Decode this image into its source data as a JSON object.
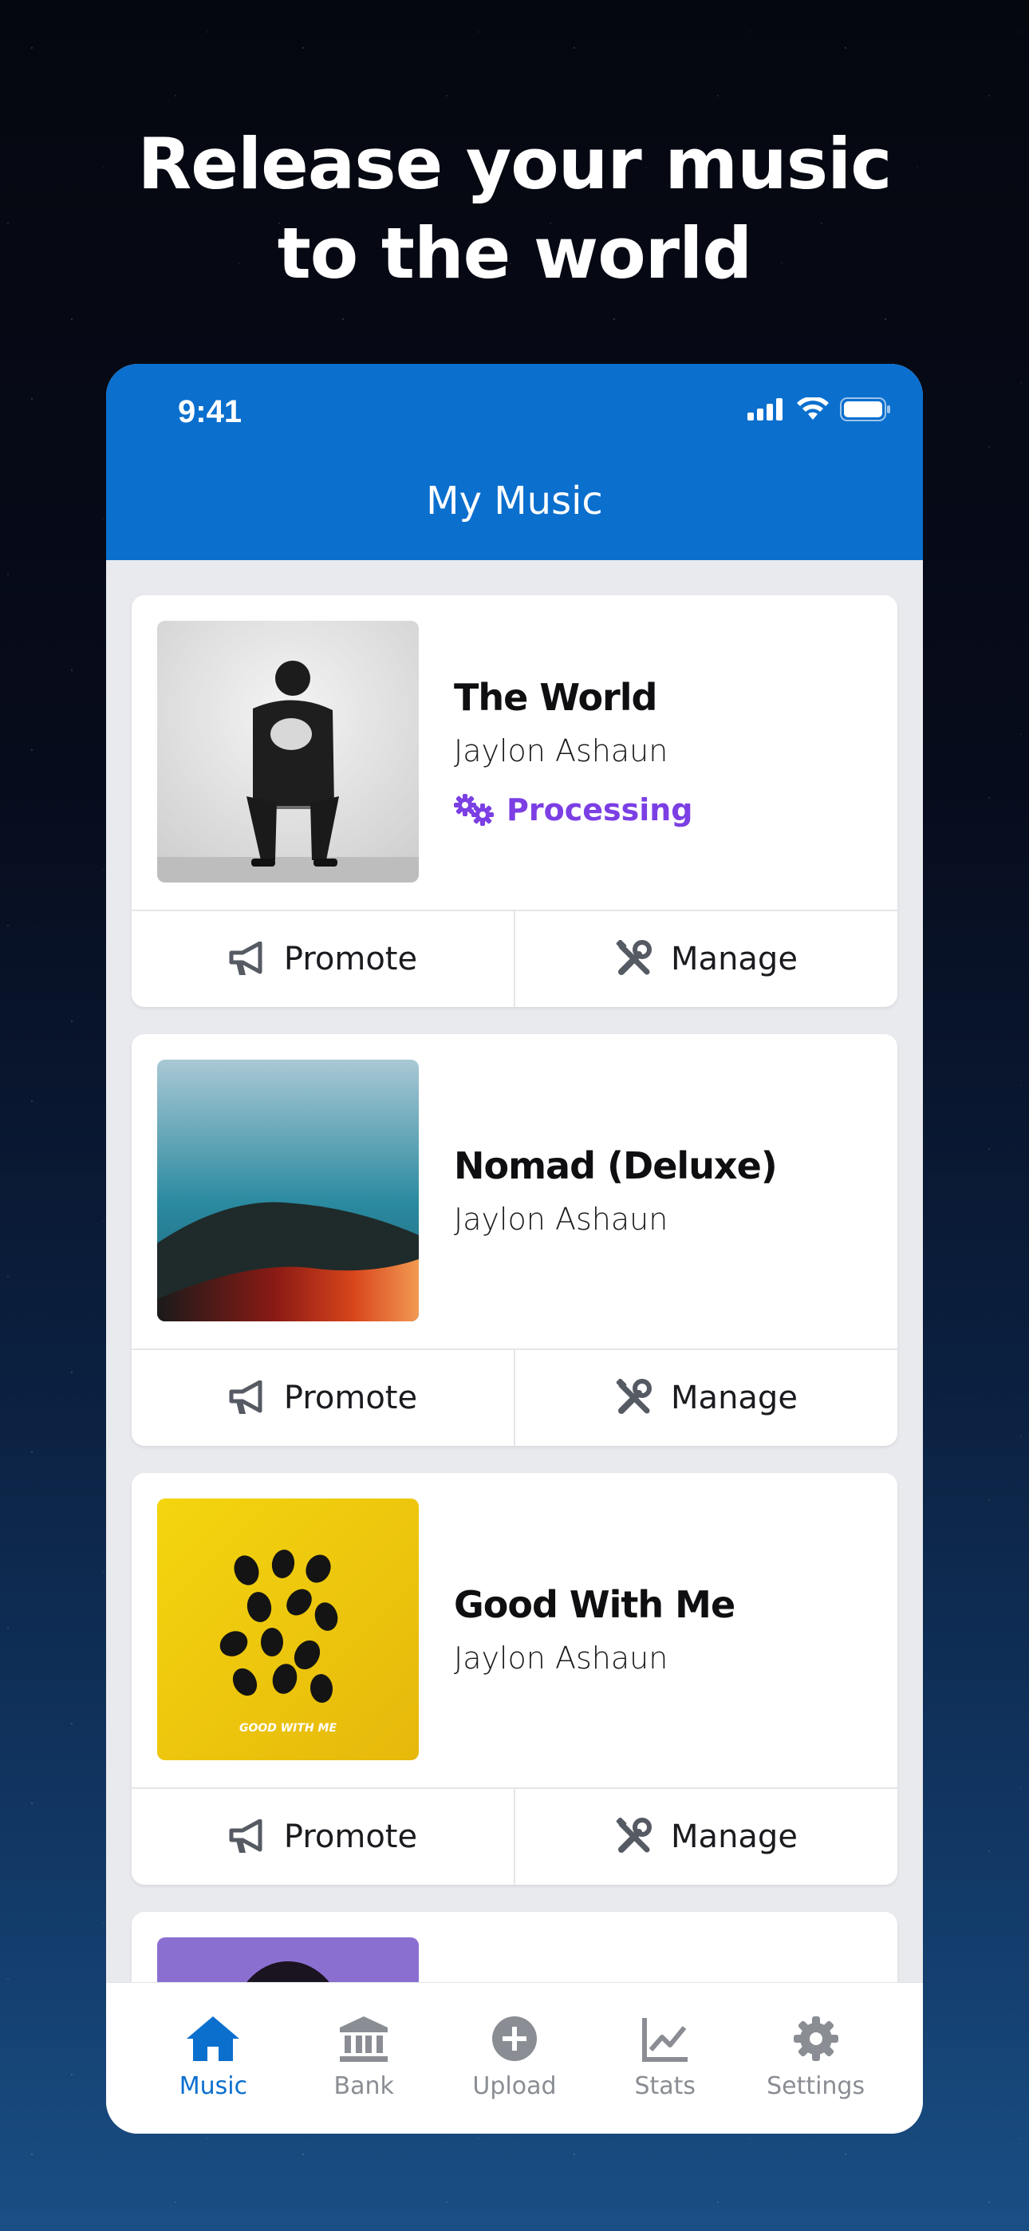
{
  "headline": {
    "line1": "Release your music",
    "line2": "to the world"
  },
  "status_bar": {
    "time": "9:41",
    "icons": [
      "signal-icon",
      "wifi-icon",
      "battery-icon"
    ]
  },
  "app": {
    "title": "My Music"
  },
  "releases": [
    {
      "title": "The World",
      "artist": "Jaylon Ashaun",
      "status": "Processing",
      "cover": "grayscale-portrait"
    },
    {
      "title": "Nomad (Deluxe)",
      "artist": "Jaylon Ashaun",
      "cover": "teal-red-landscape"
    },
    {
      "title": "Good With Me",
      "artist": "Jaylon Ashaun",
      "cover": "yellow-smiley-faces",
      "cover_text": "GOOD WITH ME"
    }
  ],
  "actions": {
    "promote": "Promote",
    "manage": "Manage"
  },
  "tabs": [
    {
      "label": "Music",
      "icon": "home-icon",
      "active": true
    },
    {
      "label": "Bank",
      "icon": "bank-icon",
      "active": false
    },
    {
      "label": "Upload",
      "icon": "plus-circle-icon",
      "active": false
    },
    {
      "label": "Stats",
      "icon": "chart-icon",
      "active": false
    },
    {
      "label": "Settings",
      "icon": "gear-icon",
      "active": false
    }
  ],
  "colors": {
    "primary": "#0b6fce",
    "processing": "#7b3fe4",
    "tab_inactive": "#8a8d93"
  }
}
